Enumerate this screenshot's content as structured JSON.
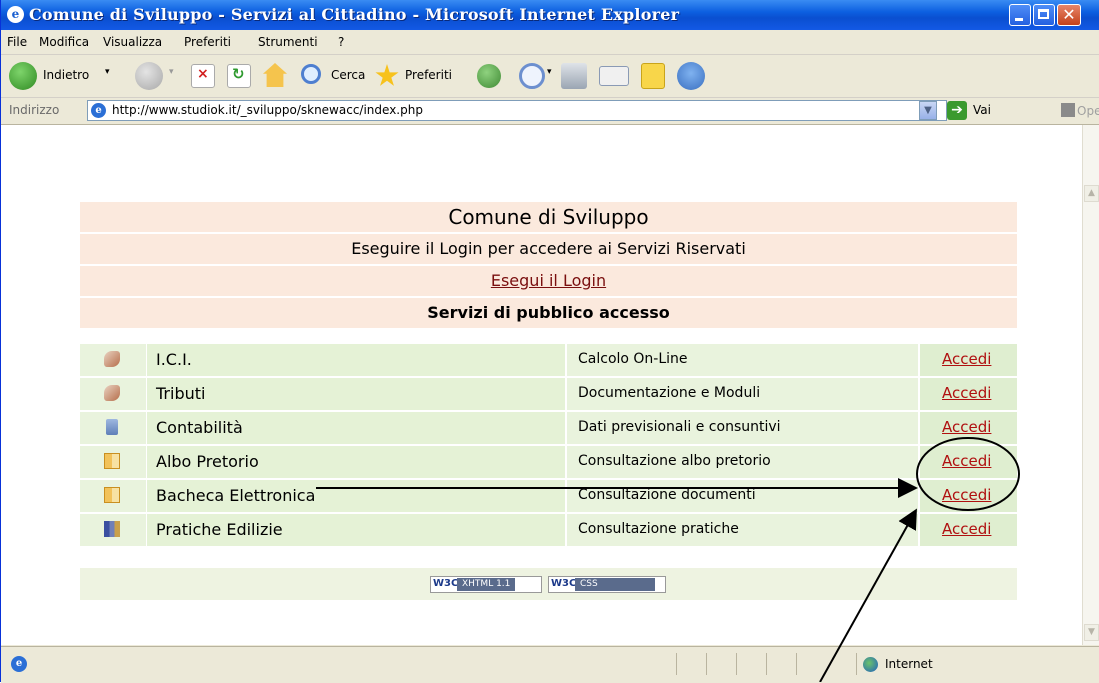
{
  "window": {
    "title": "Comune di Sviluppo - Servizi al Cittadino - Microsoft Internet Explorer",
    "close_glyph": "✕"
  },
  "menu": [
    "File",
    "Modifica",
    "Visualizza",
    "Preferiti",
    "Strumenti",
    "?"
  ],
  "toolbar": {
    "back_label": "Indietro",
    "search_label": "Cerca",
    "favorites_label": "Preferiti"
  },
  "address": {
    "label": "Indirizzo",
    "url": "http://www.studiok.it/_sviluppo/sknewacc/index.php",
    "go_label": "Vai",
    "open_label": "Open"
  },
  "page": {
    "title": "Comune di Sviluppo",
    "subtitle": "Eseguire il Login per accedere ai Servizi Riservati",
    "login_link": "Esegui il Login",
    "section_header": "Servizi di pubblico accesso",
    "services": [
      {
        "icon": "calculator-icon",
        "name": "I.C.I.",
        "description": "Calcolo On-Line",
        "action": "Accedi"
      },
      {
        "icon": "calculator-icon",
        "name": "Tributi",
        "description": "Documentazione e Moduli",
        "action": "Accedi"
      },
      {
        "icon": "ledger-icon",
        "name": "Contabilità",
        "description": "Dati previsionali e consuntivi",
        "action": "Accedi"
      },
      {
        "icon": "book-icon",
        "name": "Albo Pretorio",
        "description": "Consultazione albo pretorio",
        "action": "Accedi"
      },
      {
        "icon": "book-icon",
        "name": "Bacheca Elettronica",
        "description": "Consultazione documenti",
        "action": "Accedi"
      },
      {
        "icon": "binders-icon",
        "name": "Pratiche Edilizie",
        "description": "Consultazione pratiche",
        "action": "Accedi"
      }
    ],
    "badges": {
      "xhtml_w3c": "W3C",
      "xhtml_label": "XHTML 1.1",
      "css_w3c": "W3C",
      "css_label": "CSS"
    }
  },
  "status": {
    "zone": "Internet"
  },
  "colors": {
    "title_bar": "#0c5fe0",
    "header_row": "#fbe9dd",
    "service_row": "#e5f2d6",
    "link": "#b01010"
  }
}
